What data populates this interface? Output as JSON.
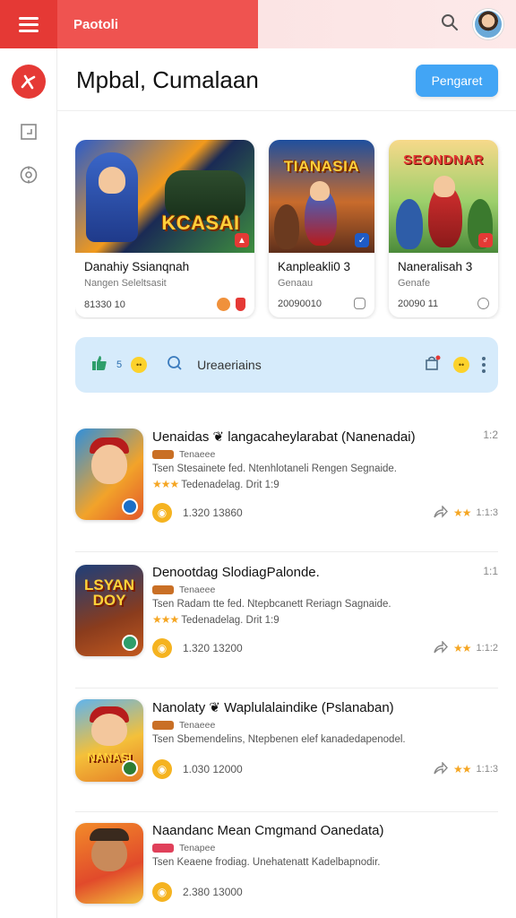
{
  "topbar": {
    "brand_label": "Paotoli"
  },
  "header": {
    "title": "Mpbal, Cumalaan",
    "primary_button": "Pengaret"
  },
  "featured": [
    {
      "art_text": "KCASAI",
      "title": "Danahiy Ssianqnah",
      "subtitle": "Nangen Seleltsasit",
      "meta": "81330 10"
    },
    {
      "art_text": "TIANASIA",
      "title": "Kanpleakli0 3",
      "subtitle": "Genaau",
      "meta": "20090010"
    },
    {
      "art_text": "SEONDNAR",
      "title": "Naneralisah 3",
      "subtitle": "Genafe",
      "meta": "20090 11"
    }
  ],
  "filterbar": {
    "count": "5",
    "label": "Ureaeriains"
  },
  "list": [
    {
      "title": "Uenaidas ❦ langacaheylarabat (Nanenadai)",
      "time": "1:2",
      "sub": "Tenaeee",
      "desc": "Tsen Stesainete fed. Ntenhlotaneli Rengen Segnaide.",
      "rating_text": "Tedenadelag. Drit 1:9",
      "stat": "1.320 13860",
      "right_value": "1:1:3",
      "thumb_word": ""
    },
    {
      "title": "Denootdag SlodiagPalonde.",
      "time": "1:1",
      "sub": "Tenaeee",
      "desc": "Tsen Radam tte fed. Ntepbcanett Reriagn Sagnaide.",
      "rating_text": "Tedenadelag. Drit 1:9",
      "stat": "1.320 13200",
      "right_value": "1:1:2",
      "thumb_word": "LSYAN DOY"
    },
    {
      "title": "Nanolaty ❦ Waplulalaindike (Pslanaban)",
      "time": "",
      "sub": "Tenaeee",
      "desc": "Tsen Sbemendelins, Ntepbenen elef kanadedapenodel.",
      "rating_text": "",
      "stat": "1.030 12000",
      "right_value": "1:1:3",
      "thumb_word": "NANASI"
    },
    {
      "title": "Naandanc Mean Cmgmand Oanedata)",
      "time": "",
      "sub": "Tenapee",
      "desc": "Tsen Keaene frodiag. Unehatenatt Kadelbapnodir.",
      "rating_text": "",
      "stat": "2.380 13000",
      "right_value": "",
      "thumb_word": ""
    }
  ],
  "colors": {
    "accent_red": "#e53935",
    "primary_blue": "#42a5f5",
    "filter_bg": "#d6ebfb",
    "star": "#f5a623"
  },
  "icons": [
    "menu-icon",
    "search-icon",
    "brand-icon",
    "crop-icon",
    "target-icon",
    "thumbs-up-icon",
    "search-icon",
    "share-icon",
    "more-vertical-icon"
  ]
}
